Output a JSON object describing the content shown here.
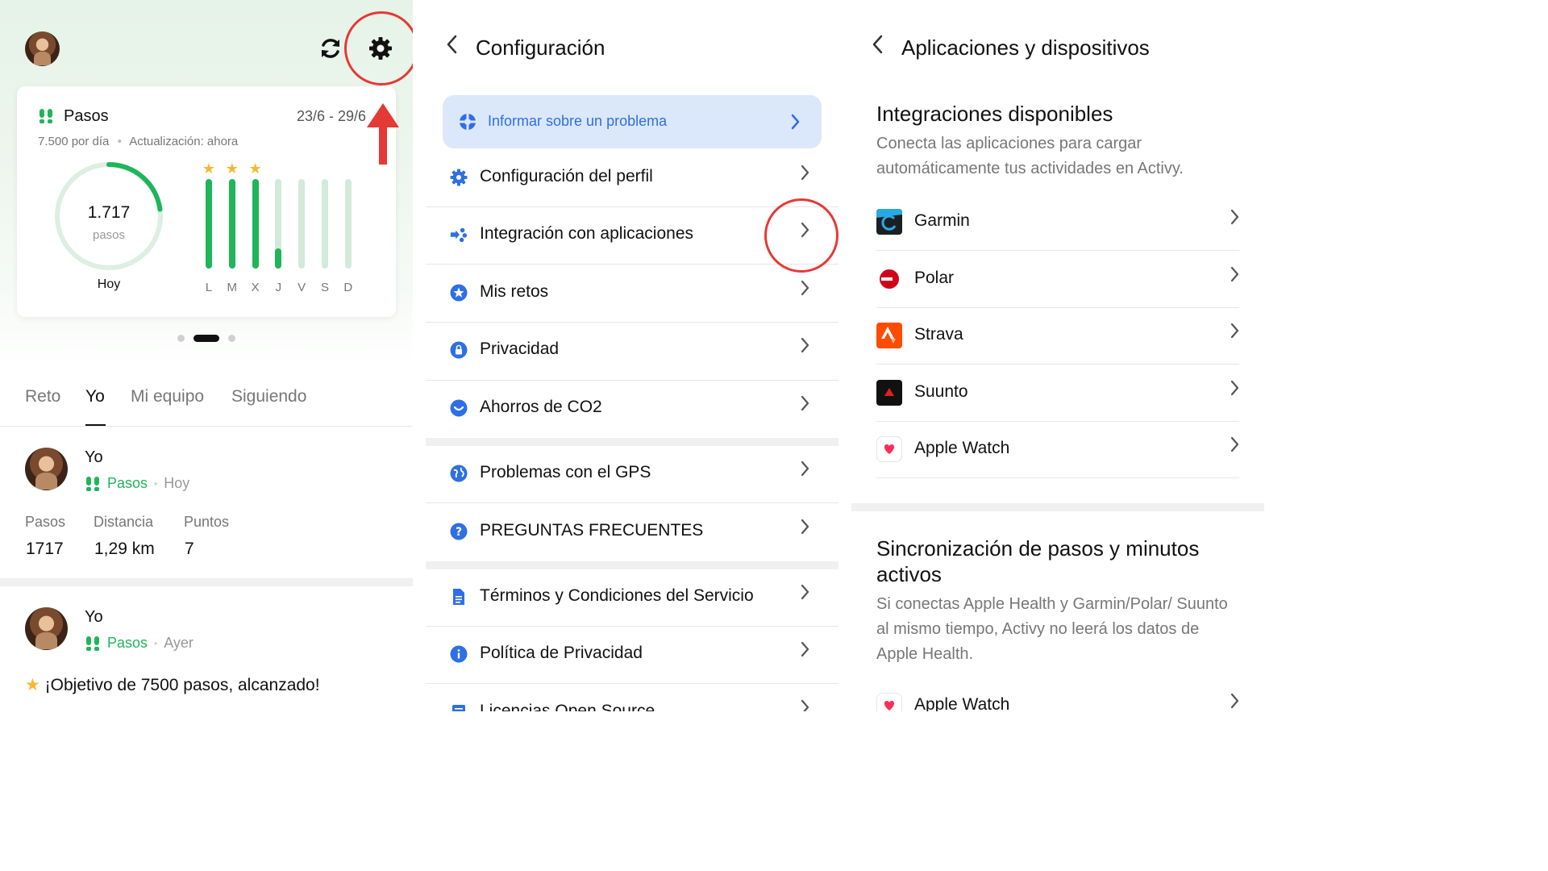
{
  "home": {
    "card": {
      "title": "Pasos",
      "date_range": "23/6 - 29/6",
      "daily_goal": "7.500 por día",
      "update_status": "Actualización: ahora",
      "today_value": "1.717",
      "today_unit": "pasos",
      "today_label": "Hoy",
      "ring_progress": 0.229,
      "days": [
        {
          "label": "L",
          "fill": 1.0,
          "star": true
        },
        {
          "label": "M",
          "fill": 1.0,
          "star": true
        },
        {
          "label": "X",
          "fill": 1.0,
          "star": true
        },
        {
          "label": "J",
          "fill": 0.229,
          "star": false
        },
        {
          "label": "V",
          "fill": 0,
          "star": false
        },
        {
          "label": "S",
          "fill": 0,
          "star": false
        },
        {
          "label": "D",
          "fill": 0,
          "star": false
        }
      ]
    },
    "tabs": [
      "Reto",
      "Yo",
      "Mi equipo",
      "Siguiendo"
    ],
    "active_tab": "Yo",
    "feed": [
      {
        "name": "Yo",
        "activity": "Pasos",
        "when": "Hoy",
        "stats": [
          {
            "label": "Pasos",
            "value": "1717"
          },
          {
            "label": "Distancia",
            "value": "1,29 km"
          },
          {
            "label": "Puntos",
            "value": "7"
          }
        ]
      },
      {
        "name": "Yo",
        "activity": "Pasos",
        "when": "Ayer",
        "message": "¡Objetivo de 7500 pasos, alcanzado!"
      }
    ],
    "highlight_color": "#e53935",
    "accent_green": "#1fb55a"
  },
  "settings": {
    "title": "Configuración",
    "report_problem": "Informar sobre un problema",
    "items": [
      {
        "label": "Configuración del perfil",
        "icon": "gear-icon"
      },
      {
        "label": "Integración con aplicaciones",
        "icon": "integration-icon"
      },
      {
        "label": "Mis retos",
        "icon": "star-badge-icon"
      },
      {
        "label": "Privacidad",
        "icon": "lock-icon"
      },
      {
        "label": "Ahorros de CO2",
        "icon": "leaf-icon"
      },
      {
        "label": "Problemas con el GPS",
        "icon": "globe-icon"
      },
      {
        "label": "PREGUNTAS FRECUENTES",
        "icon": "help-icon"
      },
      {
        "label": "Términos y Condiciones del Servicio",
        "icon": "document-icon"
      },
      {
        "label": "Política de Privacidad",
        "icon": "info-icon"
      },
      {
        "label": "Licencias Open Source",
        "icon": "license-icon"
      }
    ],
    "accent_blue": "#2f6fe4"
  },
  "apps": {
    "title": "Aplicaciones y dispositivos",
    "available_title": "Integraciones disponibles",
    "available_desc": "Conecta las aplicaciones para cargar automáticamente tus actividades en Activy.",
    "integrations": [
      {
        "name": "Garmin",
        "icon": "garmin-logo"
      },
      {
        "name": "Polar",
        "icon": "polar-logo"
      },
      {
        "name": "Strava",
        "icon": "strava-logo"
      },
      {
        "name": "Suunto",
        "icon": "suunto-logo"
      },
      {
        "name": "Apple Watch",
        "icon": "apple-health-logo"
      }
    ],
    "sync_title": "Sincronización de pasos y minutos activos",
    "sync_desc": "Si conectas Apple Health y Garmin/Polar/ Suunto al mismo tiempo, Activy no leerá los datos de Apple Health.",
    "sync_items": [
      {
        "name": "Apple Watch",
        "icon": "apple-health-logo"
      }
    ]
  }
}
